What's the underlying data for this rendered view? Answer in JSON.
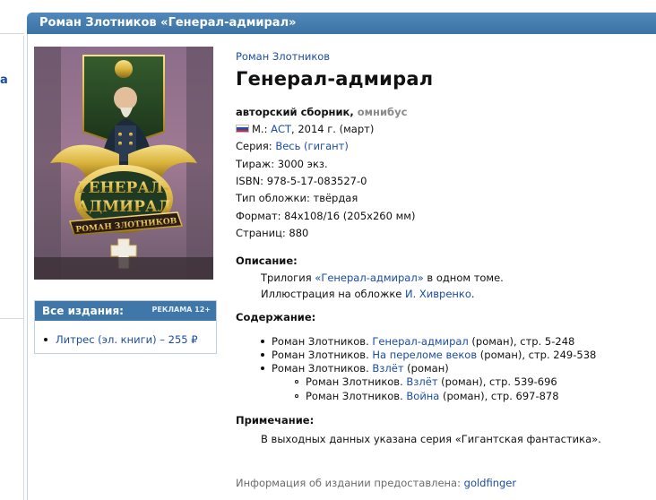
{
  "header": {
    "title": "Роман Злотников «Генерал-адмирал»"
  },
  "left_fragment": "а",
  "cover": {
    "title_line1": "ГЕНЕРАЛ-",
    "title_line2": "АДМИРАЛ",
    "author": "РОМАН ЗЛОТНИКОВ"
  },
  "editions": {
    "title": "Все издания:",
    "ad": "РЕКЛАМА 12+",
    "item": "Литрес (эл. книги) – 255 ₽"
  },
  "book": {
    "author": "Роман Злотников",
    "title": "Генерал-адмирал",
    "type": "авторский сборник,",
    "type_sub": "омнибус",
    "publisher_prefix": "М.:",
    "publisher": "АСТ",
    "publisher_suffix": ", 2014 г. (март)",
    "series_label": "Серия:",
    "series": "Весь (гигант)",
    "print_run": "Тираж: 3000 экз.",
    "isbn": "ISBN: 978-5-17-083527-0",
    "binding": "Тип обложки: твёрдая",
    "format": "Формат: 84x108/16 (205x260 мм)",
    "pages": "Страниц: 880"
  },
  "description": {
    "heading": "Описание:",
    "line1_a": "Трилогия ",
    "line1_link": "«Генерал-адмирал»",
    "line1_b": " в одном томе.",
    "line2_a": "Иллюстрация на обложке ",
    "line2_link": "И. Хивренко",
    "line2_b": "."
  },
  "contents": {
    "heading": "Содержание:",
    "items": [
      {
        "author": "Роман Злотников. ",
        "title": "Генерал-адмирал",
        "info": " (роман), стр. 5-248"
      },
      {
        "author": "Роман Злотников. ",
        "title": "На переломе веков",
        "info": " (роман), стр. 249-538"
      },
      {
        "author": "Роман Злотников. ",
        "title": "Взлёт",
        "info": " (роман)"
      }
    ],
    "subitems": [
      {
        "author": "Роман Злотников. ",
        "title": "Взлёт",
        "info": " (роман), стр. 539-696"
      },
      {
        "author": "Роман Злотников. ",
        "title": "Война",
        "info": " (роман), стр. 697-878"
      }
    ]
  },
  "note": {
    "heading": "Примечание:",
    "text": "В выходных данных указана серия «Гигантская фантастика»."
  },
  "footer": {
    "text": "Информация об издании предоставлена: ",
    "user": "goldfinger"
  },
  "colors": {
    "header": "#3f77a8",
    "link": "#1a4da1",
    "accent_gold": "#d9b33c"
  }
}
